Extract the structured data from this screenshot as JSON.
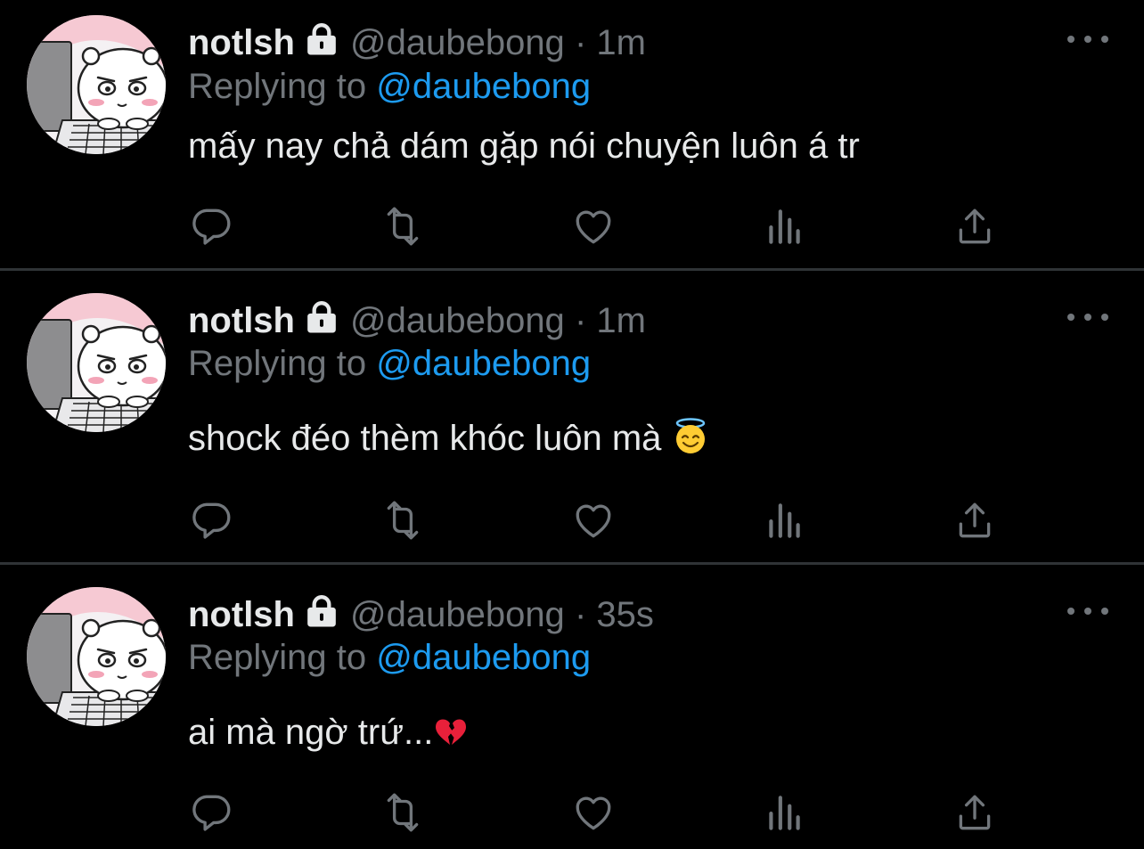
{
  "tweets": [
    {
      "name": "notlsh",
      "handle": "@daubebong",
      "separator": "·",
      "time": "1m",
      "replying_label": "Replying to",
      "replying_to": "@daubebong",
      "text": "mấy nay chả dám gặp nói chuyện luôn á tr",
      "emoji": ""
    },
    {
      "name": "notlsh",
      "handle": "@daubebong",
      "separator": "·",
      "time": "1m",
      "replying_label": "Replying to",
      "replying_to": "@daubebong",
      "text": "shock đéo thèm khóc luôn mà ",
      "emoji": "smiling-face-with-halo"
    },
    {
      "name": "notlsh",
      "handle": "@daubebong",
      "separator": "·",
      "time": "35s",
      "replying_label": "Replying to",
      "replying_to": "@daubebong",
      "text": "ai mà ngờ trứ...",
      "emoji": "broken-heart"
    }
  ],
  "icons": {
    "reply": "comment-bubble-icon",
    "retweet": "retweet-icon",
    "like": "heart-icon",
    "views": "analytics-bars-icon",
    "share": "share-upload-icon",
    "more": "more-dots-icon",
    "protected": "lock-icon"
  },
  "colors": {
    "background": "#000000",
    "primary_text": "#e7e9ea",
    "secondary_text": "#71767b",
    "link": "#1d9bf0",
    "divider": "#2f3336"
  }
}
